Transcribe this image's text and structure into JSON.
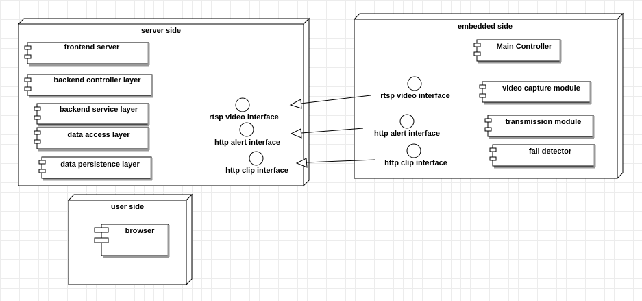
{
  "nodes": {
    "server": {
      "label": "server side",
      "components": [
        "frontend server",
        "backend controller layer",
        "backend service layer",
        "data access layer",
        "data persistence layer"
      ],
      "interfaces": [
        "rtsp video interface",
        "http alert interface",
        "http clip interface"
      ]
    },
    "embedded": {
      "label": "embedded side",
      "components": [
        "Main Controller",
        "video capture module",
        "transmission module",
        "fall detector"
      ],
      "interfaces": [
        "rtsp video interface",
        "http alert interface",
        "http clip interface"
      ]
    },
    "user": {
      "label": "user side",
      "components": [
        "browser"
      ]
    }
  }
}
